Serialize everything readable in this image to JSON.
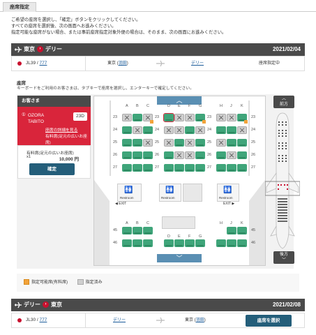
{
  "page": {
    "tab": "座席指定"
  },
  "intro": [
    "ご希望の座席を選択し、「確定」ボタンをクリックしてください。",
    "すべての座席を選択後、次の画面へお進みください。",
    "指定可能な座席がない場合、または事前座席指定対象外便の場合は、そのまま、次の画面にお進みください。"
  ],
  "flight1": {
    "from": "東京",
    "to": "デリー",
    "date": "2021/02/04",
    "airline": "JL39",
    "sep": "/",
    "flight_no": "777",
    "dep_city": "東京",
    "dep_airport": "羽田",
    "arr_city": "デリー",
    "status": "座席指定中"
  },
  "seatmap": {
    "title": "座席",
    "note": "キーボードをご利用のお客さまは、タブキーで座席を選択し、エンターキーで確定してください。",
    "front": "前方",
    "rear": "後方",
    "restroom": "Restroom",
    "exit": "EXIT"
  },
  "passenger": {
    "header": "お客さま",
    "index": "1",
    "name1": "OZORA",
    "name2": "TABITO",
    "seat": "23D",
    "detail_link": "座席の詳細を見る",
    "seat_type": "有料席(足元の広いお座席)",
    "fee_label": "有料席(足元の広いお座席)",
    "qty": "x1",
    "price": "10,000 円",
    "confirm": "確定"
  },
  "legend": {
    "paid": "指定可能席(有料席)",
    "taken": "指定済み"
  },
  "flight2": {
    "from": "デリー",
    "to": "東京",
    "date": "2021/02/08",
    "airline": "JL30",
    "sep": "/",
    "flight_no": "777",
    "dep_city": "デリー",
    "arr_city": "東京",
    "arr_airport": "羽田",
    "select": "座席を選択"
  },
  "seat_cols": [
    "A",
    "B",
    "C",
    "D",
    "E",
    "F",
    "G",
    "H",
    "J",
    "K"
  ],
  "rows_upper": [
    "23",
    "24",
    "25",
    "26",
    "27"
  ],
  "rows_lower": [
    "45",
    "46"
  ],
  "colors": {
    "available": "#3fa57a",
    "selected_border": "#d9253b",
    "paid": "#f2a33a",
    "taken": "#cfcfcf",
    "button": "#245e7a"
  }
}
